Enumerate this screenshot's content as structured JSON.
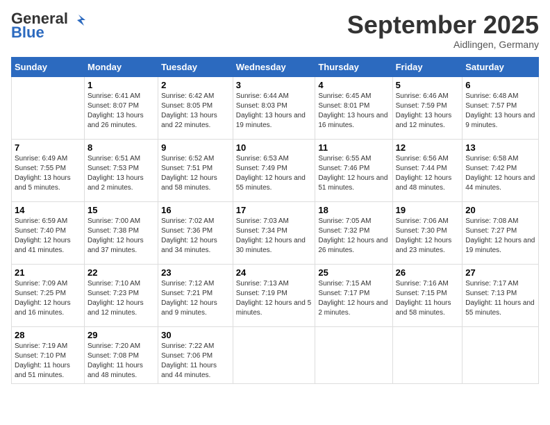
{
  "header": {
    "logo_general": "General",
    "logo_blue": "Blue",
    "month_title": "September 2025",
    "subtitle": "Aidlingen, Germany"
  },
  "weekdays": [
    "Sunday",
    "Monday",
    "Tuesday",
    "Wednesday",
    "Thursday",
    "Friday",
    "Saturday"
  ],
  "weeks": [
    [
      {
        "day": "",
        "sunrise": "",
        "sunset": "",
        "daylight": ""
      },
      {
        "day": "1",
        "sunrise": "Sunrise: 6:41 AM",
        "sunset": "Sunset: 8:07 PM",
        "daylight": "Daylight: 13 hours and 26 minutes."
      },
      {
        "day": "2",
        "sunrise": "Sunrise: 6:42 AM",
        "sunset": "Sunset: 8:05 PM",
        "daylight": "Daylight: 13 hours and 22 minutes."
      },
      {
        "day": "3",
        "sunrise": "Sunrise: 6:44 AM",
        "sunset": "Sunset: 8:03 PM",
        "daylight": "Daylight: 13 hours and 19 minutes."
      },
      {
        "day": "4",
        "sunrise": "Sunrise: 6:45 AM",
        "sunset": "Sunset: 8:01 PM",
        "daylight": "Daylight: 13 hours and 16 minutes."
      },
      {
        "day": "5",
        "sunrise": "Sunrise: 6:46 AM",
        "sunset": "Sunset: 7:59 PM",
        "daylight": "Daylight: 13 hours and 12 minutes."
      },
      {
        "day": "6",
        "sunrise": "Sunrise: 6:48 AM",
        "sunset": "Sunset: 7:57 PM",
        "daylight": "Daylight: 13 hours and 9 minutes."
      }
    ],
    [
      {
        "day": "7",
        "sunrise": "Sunrise: 6:49 AM",
        "sunset": "Sunset: 7:55 PM",
        "daylight": "Daylight: 13 hours and 5 minutes."
      },
      {
        "day": "8",
        "sunrise": "Sunrise: 6:51 AM",
        "sunset": "Sunset: 7:53 PM",
        "daylight": "Daylight: 13 hours and 2 minutes."
      },
      {
        "day": "9",
        "sunrise": "Sunrise: 6:52 AM",
        "sunset": "Sunset: 7:51 PM",
        "daylight": "Daylight: 12 hours and 58 minutes."
      },
      {
        "day": "10",
        "sunrise": "Sunrise: 6:53 AM",
        "sunset": "Sunset: 7:49 PM",
        "daylight": "Daylight: 12 hours and 55 minutes."
      },
      {
        "day": "11",
        "sunrise": "Sunrise: 6:55 AM",
        "sunset": "Sunset: 7:46 PM",
        "daylight": "Daylight: 12 hours and 51 minutes."
      },
      {
        "day": "12",
        "sunrise": "Sunrise: 6:56 AM",
        "sunset": "Sunset: 7:44 PM",
        "daylight": "Daylight: 12 hours and 48 minutes."
      },
      {
        "day": "13",
        "sunrise": "Sunrise: 6:58 AM",
        "sunset": "Sunset: 7:42 PM",
        "daylight": "Daylight: 12 hours and 44 minutes."
      }
    ],
    [
      {
        "day": "14",
        "sunrise": "Sunrise: 6:59 AM",
        "sunset": "Sunset: 7:40 PM",
        "daylight": "Daylight: 12 hours and 41 minutes."
      },
      {
        "day": "15",
        "sunrise": "Sunrise: 7:00 AM",
        "sunset": "Sunset: 7:38 PM",
        "daylight": "Daylight: 12 hours and 37 minutes."
      },
      {
        "day": "16",
        "sunrise": "Sunrise: 7:02 AM",
        "sunset": "Sunset: 7:36 PM",
        "daylight": "Daylight: 12 hours and 34 minutes."
      },
      {
        "day": "17",
        "sunrise": "Sunrise: 7:03 AM",
        "sunset": "Sunset: 7:34 PM",
        "daylight": "Daylight: 12 hours and 30 minutes."
      },
      {
        "day": "18",
        "sunrise": "Sunrise: 7:05 AM",
        "sunset": "Sunset: 7:32 PM",
        "daylight": "Daylight: 12 hours and 26 minutes."
      },
      {
        "day": "19",
        "sunrise": "Sunrise: 7:06 AM",
        "sunset": "Sunset: 7:30 PM",
        "daylight": "Daylight: 12 hours and 23 minutes."
      },
      {
        "day": "20",
        "sunrise": "Sunrise: 7:08 AM",
        "sunset": "Sunset: 7:27 PM",
        "daylight": "Daylight: 12 hours and 19 minutes."
      }
    ],
    [
      {
        "day": "21",
        "sunrise": "Sunrise: 7:09 AM",
        "sunset": "Sunset: 7:25 PM",
        "daylight": "Daylight: 12 hours and 16 minutes."
      },
      {
        "day": "22",
        "sunrise": "Sunrise: 7:10 AM",
        "sunset": "Sunset: 7:23 PM",
        "daylight": "Daylight: 12 hours and 12 minutes."
      },
      {
        "day": "23",
        "sunrise": "Sunrise: 7:12 AM",
        "sunset": "Sunset: 7:21 PM",
        "daylight": "Daylight: 12 hours and 9 minutes."
      },
      {
        "day": "24",
        "sunrise": "Sunrise: 7:13 AM",
        "sunset": "Sunset: 7:19 PM",
        "daylight": "Daylight: 12 hours and 5 minutes."
      },
      {
        "day": "25",
        "sunrise": "Sunrise: 7:15 AM",
        "sunset": "Sunset: 7:17 PM",
        "daylight": "Daylight: 12 hours and 2 minutes."
      },
      {
        "day": "26",
        "sunrise": "Sunrise: 7:16 AM",
        "sunset": "Sunset: 7:15 PM",
        "daylight": "Daylight: 11 hours and 58 minutes."
      },
      {
        "day": "27",
        "sunrise": "Sunrise: 7:17 AM",
        "sunset": "Sunset: 7:13 PM",
        "daylight": "Daylight: 11 hours and 55 minutes."
      }
    ],
    [
      {
        "day": "28",
        "sunrise": "Sunrise: 7:19 AM",
        "sunset": "Sunset: 7:10 PM",
        "daylight": "Daylight: 11 hours and 51 minutes."
      },
      {
        "day": "29",
        "sunrise": "Sunrise: 7:20 AM",
        "sunset": "Sunset: 7:08 PM",
        "daylight": "Daylight: 11 hours and 48 minutes."
      },
      {
        "day": "30",
        "sunrise": "Sunrise: 7:22 AM",
        "sunset": "Sunset: 7:06 PM",
        "daylight": "Daylight: 11 hours and 44 minutes."
      },
      {
        "day": "",
        "sunrise": "",
        "sunset": "",
        "daylight": ""
      },
      {
        "day": "",
        "sunrise": "",
        "sunset": "",
        "daylight": ""
      },
      {
        "day": "",
        "sunrise": "",
        "sunset": "",
        "daylight": ""
      },
      {
        "day": "",
        "sunrise": "",
        "sunset": "",
        "daylight": ""
      }
    ]
  ]
}
